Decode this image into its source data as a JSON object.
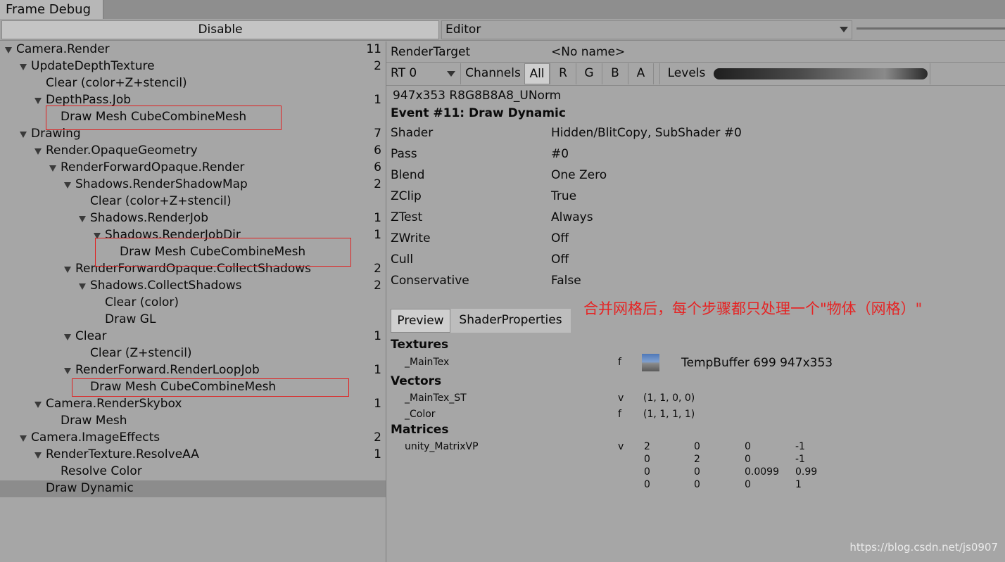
{
  "window": {
    "tab_title": "Frame Debug"
  },
  "toolbar": {
    "disable_label": "Disable",
    "target_select": "Editor"
  },
  "tree": [
    {
      "label": "Camera.Render",
      "count": "11",
      "expand": true
    },
    {
      "label": "UpdateDepthTexture",
      "count": "2",
      "expand": true
    },
    {
      "label": "Clear (color+Z+stencil)",
      "count": "",
      "expand": false
    },
    {
      "label": "DepthPass.Job",
      "count": "1",
      "expand": true
    },
    {
      "label": "Draw Mesh CubeCombineMesh",
      "count": "",
      "expand": false
    },
    {
      "label": "Drawing",
      "count": "7",
      "expand": true
    },
    {
      "label": "Render.OpaqueGeometry",
      "count": "6",
      "expand": true
    },
    {
      "label": "RenderForwardOpaque.Render",
      "count": "6",
      "expand": true
    },
    {
      "label": "Shadows.RenderShadowMap",
      "count": "2",
      "expand": true
    },
    {
      "label": "Clear (color+Z+stencil)",
      "count": "",
      "expand": false
    },
    {
      "label": "Shadows.RenderJob",
      "count": "1",
      "expand": true
    },
    {
      "label": "Shadows.RenderJobDir",
      "count": "1",
      "expand": true
    },
    {
      "label": "Draw Mesh CubeCombineMesh",
      "count": "",
      "expand": false
    },
    {
      "label": "RenderForwardOpaque.CollectShadows",
      "count": "2",
      "expand": true
    },
    {
      "label": "Shadows.CollectShadows",
      "count": "2",
      "expand": true
    },
    {
      "label": "Clear (color)",
      "count": "",
      "expand": false
    },
    {
      "label": "Draw GL",
      "count": "",
      "expand": false
    },
    {
      "label": "Clear",
      "count": "1",
      "expand": true
    },
    {
      "label": "Clear (Z+stencil)",
      "count": "",
      "expand": false
    },
    {
      "label": "RenderForward.RenderLoopJob",
      "count": "1",
      "expand": true
    },
    {
      "label": "Draw Mesh CubeCombineMesh",
      "count": "",
      "expand": false
    },
    {
      "label": "Camera.RenderSkybox",
      "count": "1",
      "expand": true
    },
    {
      "label": "Draw Mesh",
      "count": "",
      "expand": false
    },
    {
      "label": "Camera.ImageEffects",
      "count": "2",
      "expand": true
    },
    {
      "label": "RenderTexture.ResolveAA",
      "count": "1",
      "expand": true
    },
    {
      "label": "Resolve Color",
      "count": "",
      "expand": false
    },
    {
      "label": "Draw Dynamic",
      "count": "",
      "expand": false
    }
  ],
  "detail": {
    "render_target_label": "RenderTarget",
    "render_target_value": "<No name>",
    "rt_select": "RT 0",
    "channels_label": "Channels",
    "channels": [
      "All",
      "R",
      "G",
      "B",
      "A"
    ],
    "levels_label": "Levels",
    "format": "947x353 R8G8B8A8_UNorm",
    "event_title": "Event #11: Draw Dynamic",
    "props": [
      {
        "k": "Shader",
        "v": "Hidden/BlitCopy, SubShader #0"
      },
      {
        "k": "Pass",
        "v": "#0"
      },
      {
        "k": "Blend",
        "v": "One Zero"
      },
      {
        "k": "ZClip",
        "v": "True"
      },
      {
        "k": "ZTest",
        "v": "Always"
      },
      {
        "k": "ZWrite",
        "v": "Off"
      },
      {
        "k": "Cull",
        "v": "Off"
      },
      {
        "k": "Conservative",
        "v": "False"
      }
    ],
    "tabs": [
      "Preview",
      "ShaderProperties"
    ],
    "textures_title": "Textures",
    "maintex": {
      "name": "_MainTex",
      "type": "f",
      "value": "TempBuffer 699 947x353"
    },
    "vectors_title": "Vectors",
    "vectors": [
      {
        "name": "_MainTex_ST",
        "type": "v",
        "value": "(1, 1, 0, 0)"
      },
      {
        "name": "_Color",
        "type": "f",
        "value": "(1, 1, 1, 1)"
      }
    ],
    "matrices_title": "Matrices",
    "matrix": {
      "name": "unity_MatrixVP",
      "type": "v",
      "rows": [
        [
          "2",
          "0",
          "0",
          "-1"
        ],
        [
          "0",
          "2",
          "0",
          "-1"
        ],
        [
          "0",
          "0",
          "0.0099",
          "0.99"
        ],
        [
          "0",
          "0",
          "0",
          "1"
        ]
      ]
    }
  },
  "annotation": {
    "note": "合并网格后，每个步骤都只处理一个\"物体（网格）\"",
    "watermark": "https://blog.csdn.net/js0907",
    "highlight_color": "#e02020"
  }
}
